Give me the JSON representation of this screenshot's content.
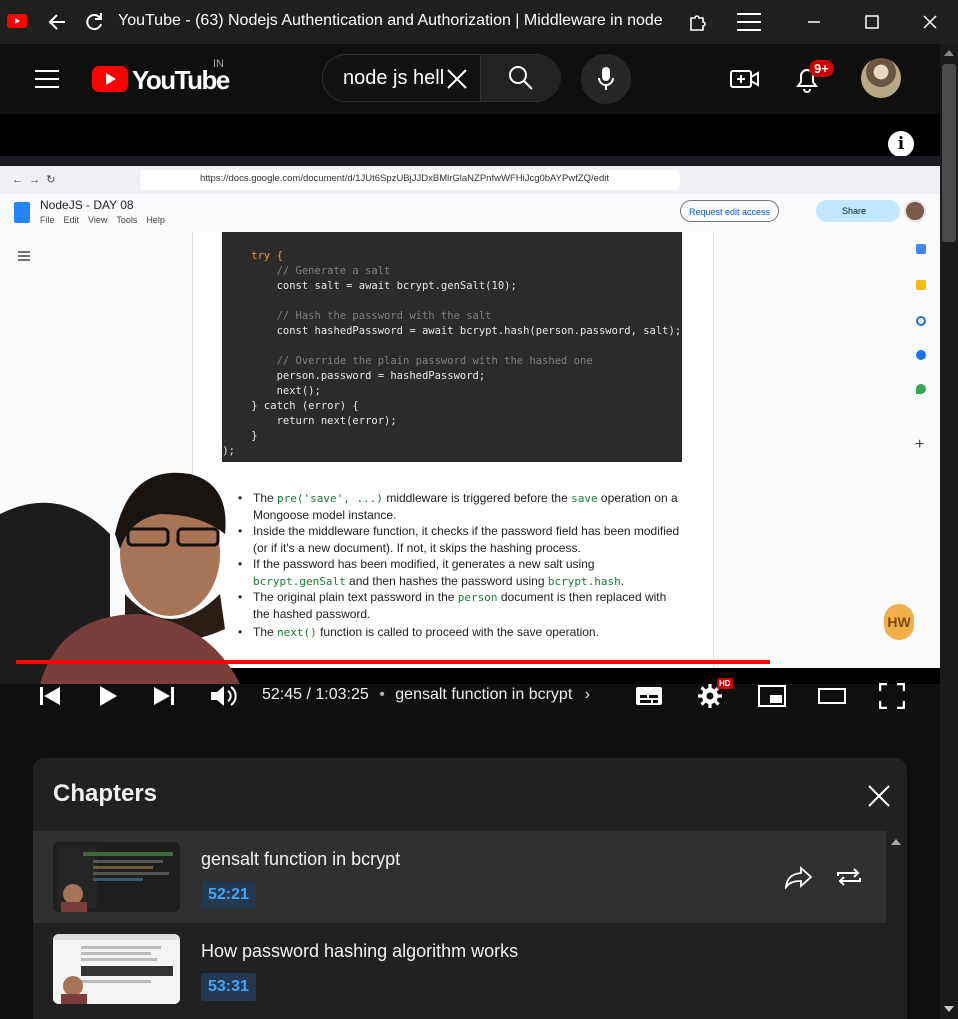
{
  "window": {
    "title": "YouTube - (63) Nodejs Authentication and Authorization | Middleware in node..."
  },
  "header": {
    "logo_text": "YouTube",
    "region": "IN",
    "search_value": "node js hell",
    "notifications_badge": "9+"
  },
  "video": {
    "info_icon": "i",
    "browser": {
      "url": "https://docs.google.com/document/d/1JUt6SpzUBjJJDxBMlrGlaNZPnfwWFHiJcg0bAYPwfZQ/edit",
      "doc_title": "NodeJS - DAY 08",
      "menu": [
        "File",
        "Edit",
        "View",
        "Tools",
        "Help"
      ],
      "request_edit": "Request edit access",
      "share": "Share"
    },
    "code_lines": [
      "    try {",
      "        // Generate a salt",
      "        const salt = await bcrypt.genSalt(10);",
      "",
      "        // Hash the password with the salt",
      "        const hashedPassword = await bcrypt.hash(person.password, salt);",
      "",
      "        // Override the plain password with the hashed one",
      "        person.password = hashedPassword;",
      "        next();",
      "    } catch (error) {",
      "        return next(error);",
      "    }",
      "});"
    ],
    "bullets": [
      {
        "pre": "The ",
        "code": "pre('save', ...)",
        "post": " middleware is triggered before the ",
        "code2": "save",
        "post2": " operation on a Mongoose model instance."
      },
      {
        "pre": "Inside the middleware function, it checks if the password field has been modified (or if it's a new document). If not, it skips the hashing process.",
        "code": "",
        "post": "",
        "code2": "",
        "post2": ""
      },
      {
        "pre": "If the password has been modified, it generates a new salt using ",
        "code": "bcrypt.genSalt",
        "post": " and then hashes the password using ",
        "code2": "bcrypt.hash",
        "post2": "."
      },
      {
        "pre": "The original plain text password in the ",
        "code": "person",
        "post": " document is then replaced with the hashed password.",
        "code2": "",
        "post2": ""
      },
      {
        "pre": "The ",
        "code": "next()",
        "post": " function is called to proceed with the save operation.",
        "code2": "",
        "post2": ""
      }
    ],
    "watermark": "HW",
    "progress_fraction": 0.83,
    "time": "52:45 / 1:03:25",
    "separator": "•",
    "chapter_label": "gensalt function in bcrypt",
    "hd_badge": "HD"
  },
  "chapters": {
    "title": "Chapters",
    "items": [
      {
        "name": "gensalt function in bcrypt",
        "time": "52:21"
      },
      {
        "name": "How password hashing algorithm works",
        "time": "53:31"
      }
    ]
  },
  "colors": {
    "accent": "#ff0000",
    "link_blue": "#3ea6ff"
  }
}
